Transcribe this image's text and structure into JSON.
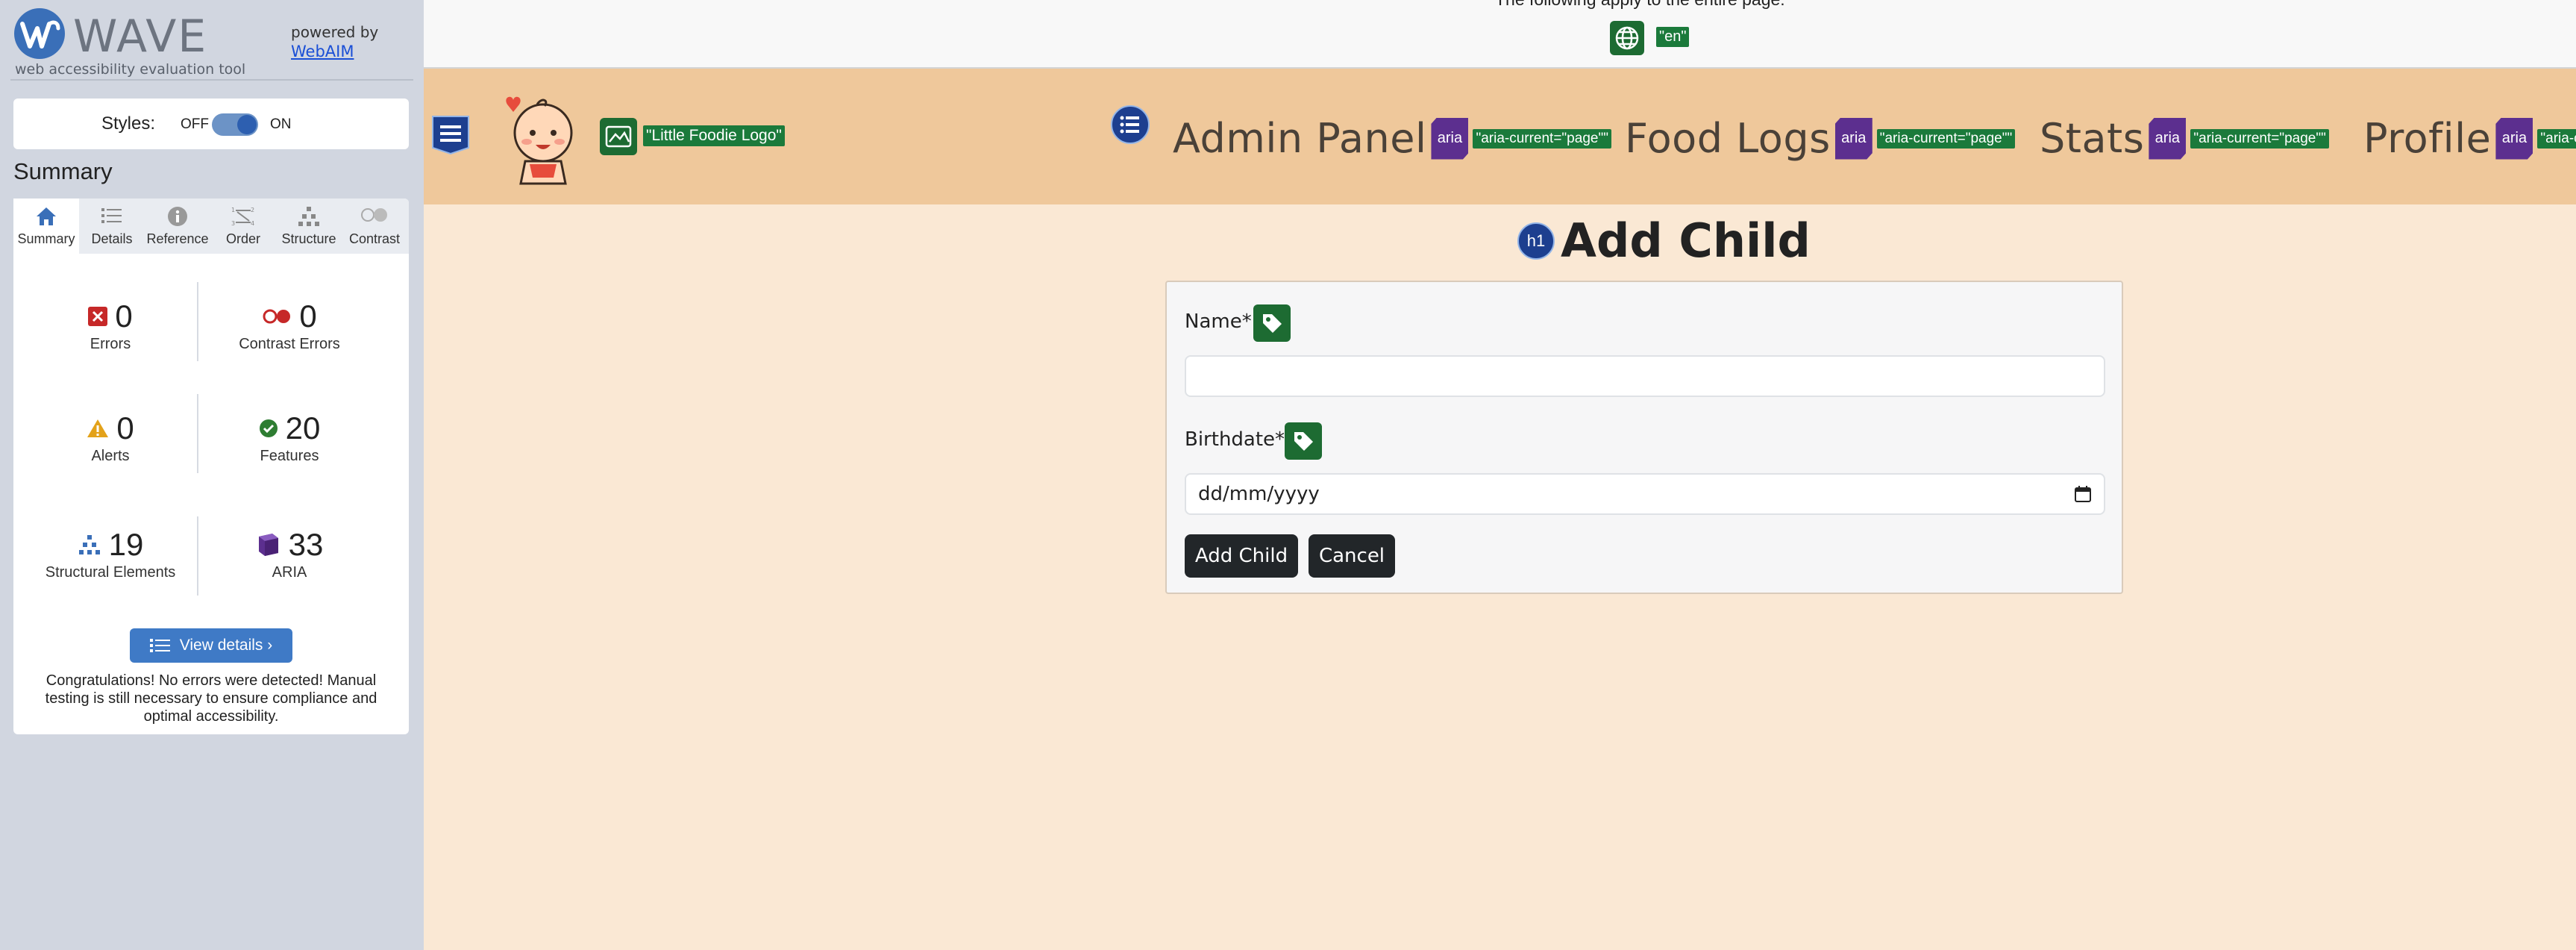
{
  "wave": {
    "brand": "WAVE",
    "tagline": "web accessibility evaluation tool",
    "powered_by": "powered by",
    "powered_link": "WebAIM",
    "styles_label": "Styles:",
    "off": "OFF",
    "on": "ON",
    "summary_heading": "Summary",
    "tabs": [
      {
        "label": "Summary",
        "icon": "home-icon"
      },
      {
        "label": "Details",
        "icon": "list-icon"
      },
      {
        "label": "Reference",
        "icon": "info-icon"
      },
      {
        "label": "Order",
        "icon": "order-icon"
      },
      {
        "label": "Structure",
        "icon": "structure-icon"
      },
      {
        "label": "Contrast",
        "icon": "contrast-icon"
      }
    ],
    "stats": {
      "errors": {
        "count": "0",
        "label": "Errors"
      },
      "contrast_errors": {
        "count": "0",
        "label": "Contrast Errors"
      },
      "alerts": {
        "count": "0",
        "label": "Alerts"
      },
      "features": {
        "count": "20",
        "label": "Features"
      },
      "structural": {
        "count": "19",
        "label": "Structural Elements"
      },
      "aria": {
        "count": "33",
        "label": "ARIA"
      }
    },
    "view_details": "View details ›",
    "congrats": "Congratulations! No errors were detected! Manual testing is still necessary to ensure compliance and optimal accessibility."
  },
  "page": {
    "notice": "The following apply to the entire page:",
    "lang_tag": "\"en\"",
    "logo_alt_tag": "\"Little Foodie Logo\"",
    "aria_badge": "aria",
    "nav": [
      {
        "label": "Admin Panel",
        "tag": "\"aria-current=\"page\"\""
      },
      {
        "label": "Food Logs",
        "tag": "\"aria-current=\"page\"\""
      },
      {
        "label": "Stats",
        "tag": "\"aria-current=\"page\"\""
      },
      {
        "label": "Profile",
        "tag": "\"aria-cu"
      }
    ],
    "h1_badge": "h1",
    "title": "Add Child",
    "form": {
      "name_label": "Name*",
      "name_value": "",
      "birthdate_label": "Birthdate*",
      "birthdate_placeholder": "dd/mm/yyyy",
      "submit": "Add Child",
      "cancel": "Cancel"
    }
  },
  "colors": {
    "sidebar_bg": "#d1d6e0",
    "navbar_bg": "#efc89b",
    "page_bg": "#fae8d4",
    "wave_green": "#1d6b32",
    "aria_purple": "#5c2f8f",
    "button_dark": "#222629"
  }
}
